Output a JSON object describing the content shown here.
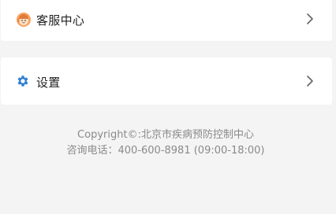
{
  "menu": {
    "items": [
      {
        "label": "客服中心",
        "icon": "customer-service-avatar-icon",
        "accent": "#f5a25d"
      },
      {
        "label": "设置",
        "icon": "gear-icon",
        "accent": "#2f7fd6"
      }
    ]
  },
  "footer": {
    "copyright": "Copyright©:北京市疾病预防控制中心",
    "hotline": "咨询电话：400-600-8981 (09:00-18:00)"
  }
}
